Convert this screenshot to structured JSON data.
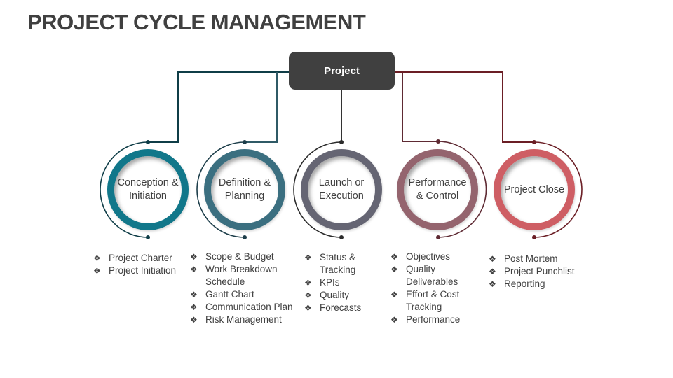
{
  "title": "PROJECT CYCLE MANAGEMENT",
  "root": {
    "label": "Project",
    "color": "#404040"
  },
  "bullet_icon": "❖",
  "stages": [
    {
      "label": "Conception & Initiation",
      "ring_color": "#11778A",
      "line_color": "#0F3D47",
      "items": [
        "Project Charter",
        "Project Initiation"
      ]
    },
    {
      "label": "Definition & Planning",
      "ring_color": "#3B6F80",
      "line_color": "#1D3E4A",
      "items": [
        "Scope & Budget",
        "Work Breakdown Schedule",
        "Gantt Chart",
        "Communication Plan",
        "Risk Management"
      ]
    },
    {
      "label": "Launch or Execution",
      "ring_color": "#656573",
      "line_color": "#2B2B2B",
      "items": [
        "Status & Tracking",
        "KPIs",
        "Quality",
        "Forecasts"
      ]
    },
    {
      "label": "Performance & Control",
      "ring_color": "#94646E",
      "line_color": "#5E2A33",
      "items": [
        "Objectives",
        "Quality Deliverables",
        "Effort & Cost Tracking",
        "Performance"
      ]
    },
    {
      "label": "Project Close",
      "ring_color": "#CE5E64",
      "line_color": "#6B1E25",
      "items": [
        "Post Mortem",
        "Project Punchlist",
        "Reporting"
      ]
    }
  ]
}
